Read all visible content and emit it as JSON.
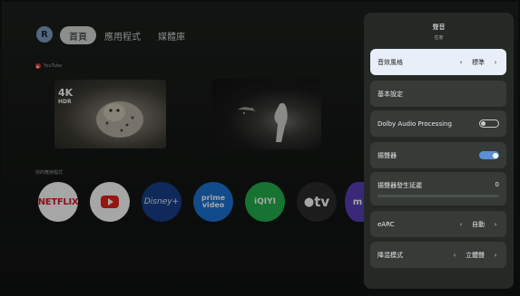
{
  "nav": {
    "avatar_initial": "R",
    "tabs": [
      {
        "label": "首頁",
        "active": true
      },
      {
        "label": "應用程式",
        "active": false
      },
      {
        "label": "媒體庫",
        "active": false
      }
    ]
  },
  "rows": {
    "youtube_label": "YouTube",
    "apps_label": "你的應用程式"
  },
  "thumbnails": {
    "leopard": {
      "badge_4k": "4K",
      "badge_hdr": "HDR"
    }
  },
  "apps": [
    {
      "name": "NETFLIX"
    },
    {
      "name": "YouTube"
    },
    {
      "name": "Disney+"
    },
    {
      "name": "prime video",
      "line1": "prime",
      "line2": "video"
    },
    {
      "name": "iQIYI"
    },
    {
      "name": "tv"
    },
    {
      "name": "m"
    }
  ],
  "settings": {
    "title": "聲音",
    "subtitle": "住家",
    "items": [
      {
        "label": "音效風格",
        "value": "標準",
        "type": "selector",
        "focused": true
      },
      {
        "label": "基本設定",
        "type": "link"
      },
      {
        "label": "Dolby Audio Processing",
        "type": "toggle",
        "state": "off"
      },
      {
        "label": "揚聲器",
        "type": "toggle",
        "state": "on"
      },
      {
        "label": "揚聲器發生延遲",
        "value": "0",
        "type": "slider",
        "level": 0
      },
      {
        "label": "eARC",
        "value": "自動",
        "type": "selector"
      },
      {
        "label": "降混模式",
        "value": "立體聲",
        "type": "selector"
      }
    ]
  },
  "colors": {
    "panel_bg": "#252926",
    "item_bg": "#363b38",
    "focus_bg": "#e9eff8",
    "toggle_on": "#5b8fd6",
    "avatar": "#7f9fc4"
  }
}
